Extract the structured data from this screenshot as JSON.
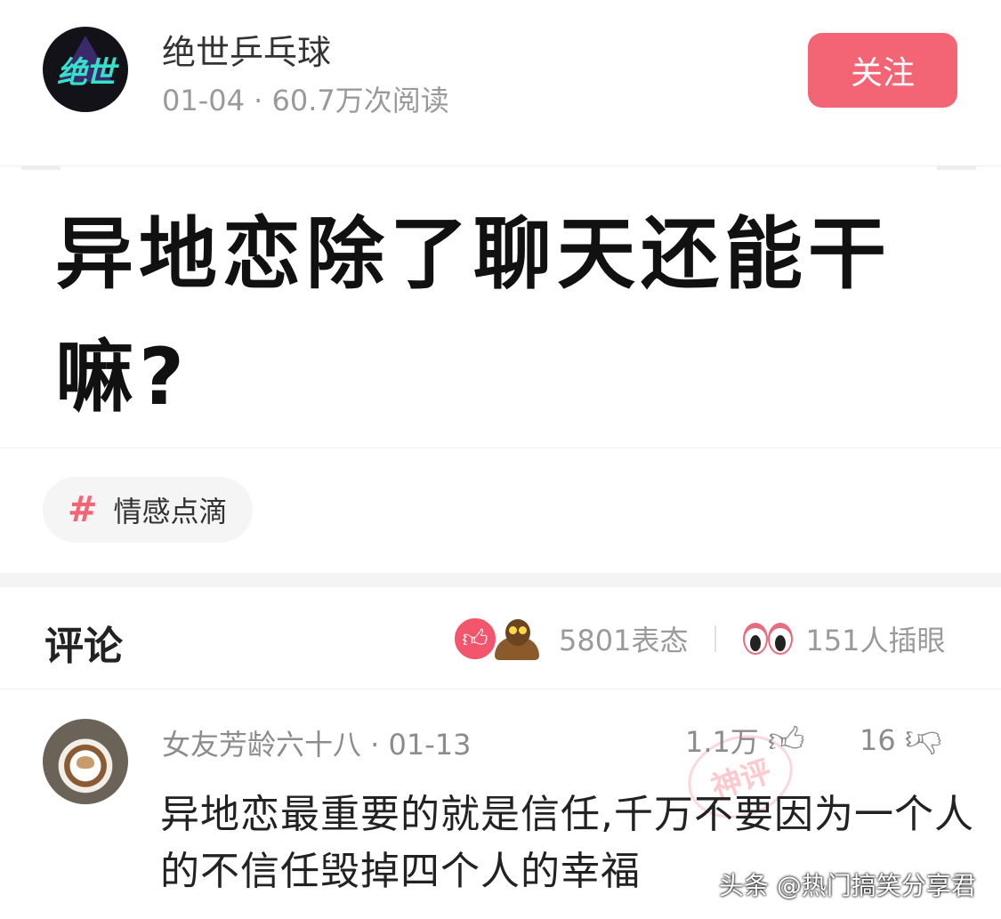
{
  "header": {
    "avatar_text": "绝世",
    "author_name": "绝世乒乓球",
    "meta": "01-04 · 60.7万次阅读",
    "follow_label": "关注"
  },
  "post": {
    "image_text": "异地恋除了聊天还能干嘛?"
  },
  "tag": {
    "icon": "#",
    "label": "情感点滴"
  },
  "comments_header": {
    "title": "评论",
    "reactions_count": "5801表态",
    "eyes_count": "151人插眼"
  },
  "comment": {
    "user_meta": "女友芳龄六十八 · 01-13",
    "likes": "1.1万",
    "dislikes": "16",
    "stamp_text": "神评",
    "text": "异地恋最重要的就是信任,千万不要因为一个人的不信任毁掉四个人的幸福"
  },
  "watermark": "头条 @热门搞笑分享君",
  "colors": {
    "accent": "#f36474",
    "muted": "#9a9a9a"
  }
}
